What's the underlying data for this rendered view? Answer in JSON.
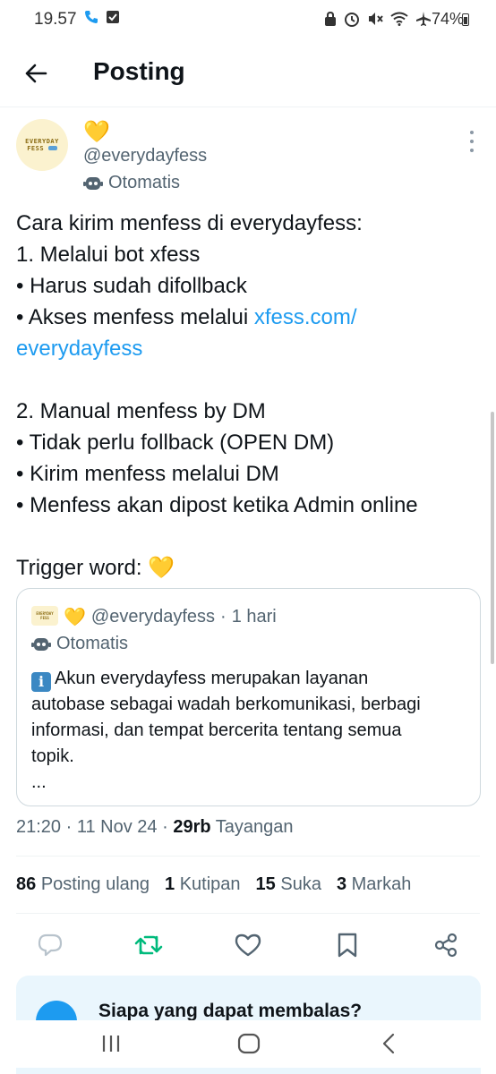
{
  "status_bar": {
    "time": "19.57",
    "battery": "74%",
    "icons": [
      "phone-call-icon",
      "check-box-icon",
      "lock-icon",
      "alarm-icon",
      "mute-icon",
      "wifi-icon",
      "airplane-icon",
      "battery-icon"
    ]
  },
  "header": {
    "title": "Posting",
    "back_icon": "arrow-left-icon"
  },
  "author": {
    "display_name": "💛",
    "handle": "@everydayfess",
    "label": "Otomatis",
    "avatar_text_line1": "EVERYDAY",
    "avatar_text_line2": "FESS"
  },
  "tweet": {
    "lines": [
      "Cara kirim menfess di everydayfess:",
      "1. Melalui bot xfess",
      "• Harus sudah difollback",
      "• Akses menfess melalui ",
      "",
      "",
      "2. Manual menfess by DM",
      "• Tidak perlu follback (OPEN DM)",
      "• Kirim menfess melalui DM",
      "• Menfess akan dipost ketika Admin online",
      "",
      "Trigger word: 💛"
    ],
    "link_part1": "xfess.com/",
    "link_part2": "everydayfess"
  },
  "quote": {
    "name": "💛",
    "handle": "@everydayfess",
    "separator": "·",
    "time": "1 hari",
    "label": "Otomatis",
    "info_glyph": "i",
    "lines": [
      "Akun everydayfess merupakan layanan",
      "autobase sebagai wadah berkomunikasi, berbagi",
      "informasi, dan tempat bercerita tentang semua",
      "topik.",
      "..."
    ]
  },
  "meta": {
    "time": "21:20",
    "date": "11 Nov 24",
    "views_count": "29rb",
    "views_label": "Tayangan",
    "separator": "·"
  },
  "stats": [
    {
      "count": "86",
      "label": "Posting ulang"
    },
    {
      "count": "1",
      "label": "Kutipan"
    },
    {
      "count": "15",
      "label": "Suka"
    },
    {
      "count": "3",
      "label": "Markah"
    }
  ],
  "actions": [
    "reply-icon",
    "repost-icon",
    "like-icon",
    "bookmark-icon",
    "share-icon"
  ],
  "reply_banner": {
    "title": "Siapa yang dapat membalas?"
  },
  "colors": {
    "accent": "#1d9bf0",
    "repost_green": "#00ba7c",
    "secondary_text": "#536471",
    "banner_bg": "#eaf6fd"
  }
}
